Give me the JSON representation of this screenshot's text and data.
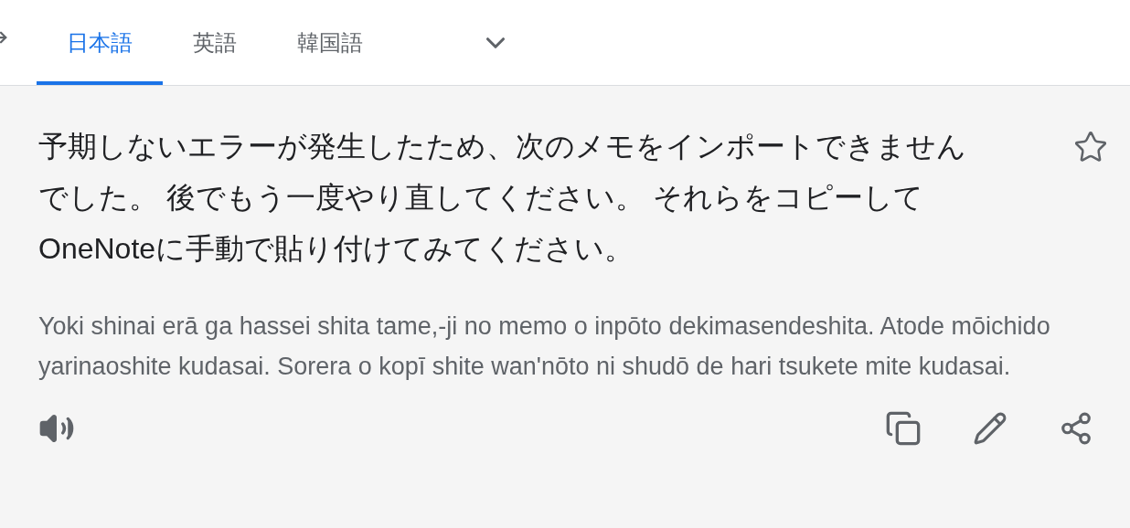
{
  "tabs": [
    {
      "label": "日本語",
      "selected": true
    },
    {
      "label": "英語",
      "selected": false
    },
    {
      "label": "韓国語",
      "selected": false
    }
  ],
  "translation": {
    "text": "予期しないエラーが発生したため、次のメモをインポートできませんでした。 後でもう一度やり直してください。 それらをコピーしてOneNoteに手動で貼り付けてみてください。",
    "starred": false,
    "romanization": "Yoki shinai erā ga hassei shita tame,-ji no memo o inpōto dekimasendeshita. Atode mōichido yarinaoshite kudasai. Sorera o kopī shite wan'nōto ni shudō de hari tsukete mite kudasai."
  }
}
